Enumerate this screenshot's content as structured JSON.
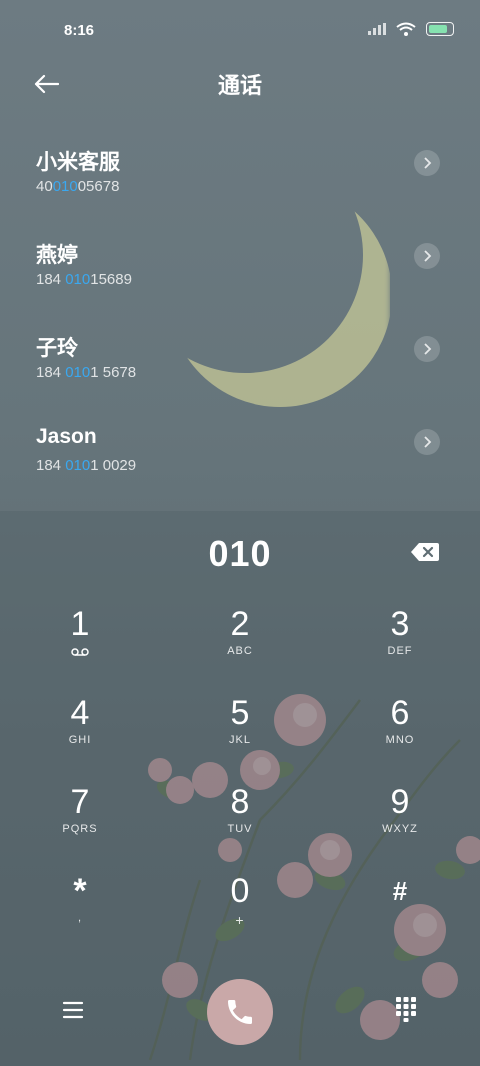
{
  "status": {
    "time": "8:16"
  },
  "header": {
    "title": "通话"
  },
  "contacts": [
    {
      "name": "小米客服",
      "number_pre": "40",
      "number_match": "010",
      "number_post": "05678"
    },
    {
      "name": "燕婷",
      "number_pre": "184 ",
      "number_match": "010",
      "number_post": "15689"
    },
    {
      "name": "子玲",
      "number_pre": "184 ",
      "number_match": "010",
      "number_post": "1 5678"
    },
    {
      "name": "Jason",
      "number_pre": "184 ",
      "number_match": "010",
      "number_post": "1 0029"
    }
  ],
  "dialer": {
    "display": "010",
    "keys": [
      {
        "digit": "1",
        "letters": ""
      },
      {
        "digit": "2",
        "letters": "ABC"
      },
      {
        "digit": "3",
        "letters": "DEF"
      },
      {
        "digit": "4",
        "letters": "GHI"
      },
      {
        "digit": "5",
        "letters": "JKL"
      },
      {
        "digit": "6",
        "letters": "MNO"
      },
      {
        "digit": "7",
        "letters": "PQRS"
      },
      {
        "digit": "8",
        "letters": "TUV"
      },
      {
        "digit": "9",
        "letters": "WXYZ"
      },
      {
        "digit": "*",
        "letters": ","
      },
      {
        "digit": "0",
        "letters": "+"
      },
      {
        "digit": "#",
        "letters": ""
      }
    ]
  },
  "colors": {
    "highlight": "#3aa8f0",
    "call_button": "#c9a8a8",
    "battery": "#86e2b0"
  },
  "icons": [
    "back-arrow-icon",
    "chevron-right-icon",
    "backspace-icon",
    "voicemail-icon",
    "menu-icon",
    "phone-icon",
    "keypad-icon",
    "signal-icon",
    "wifi-icon",
    "battery-icon"
  ]
}
